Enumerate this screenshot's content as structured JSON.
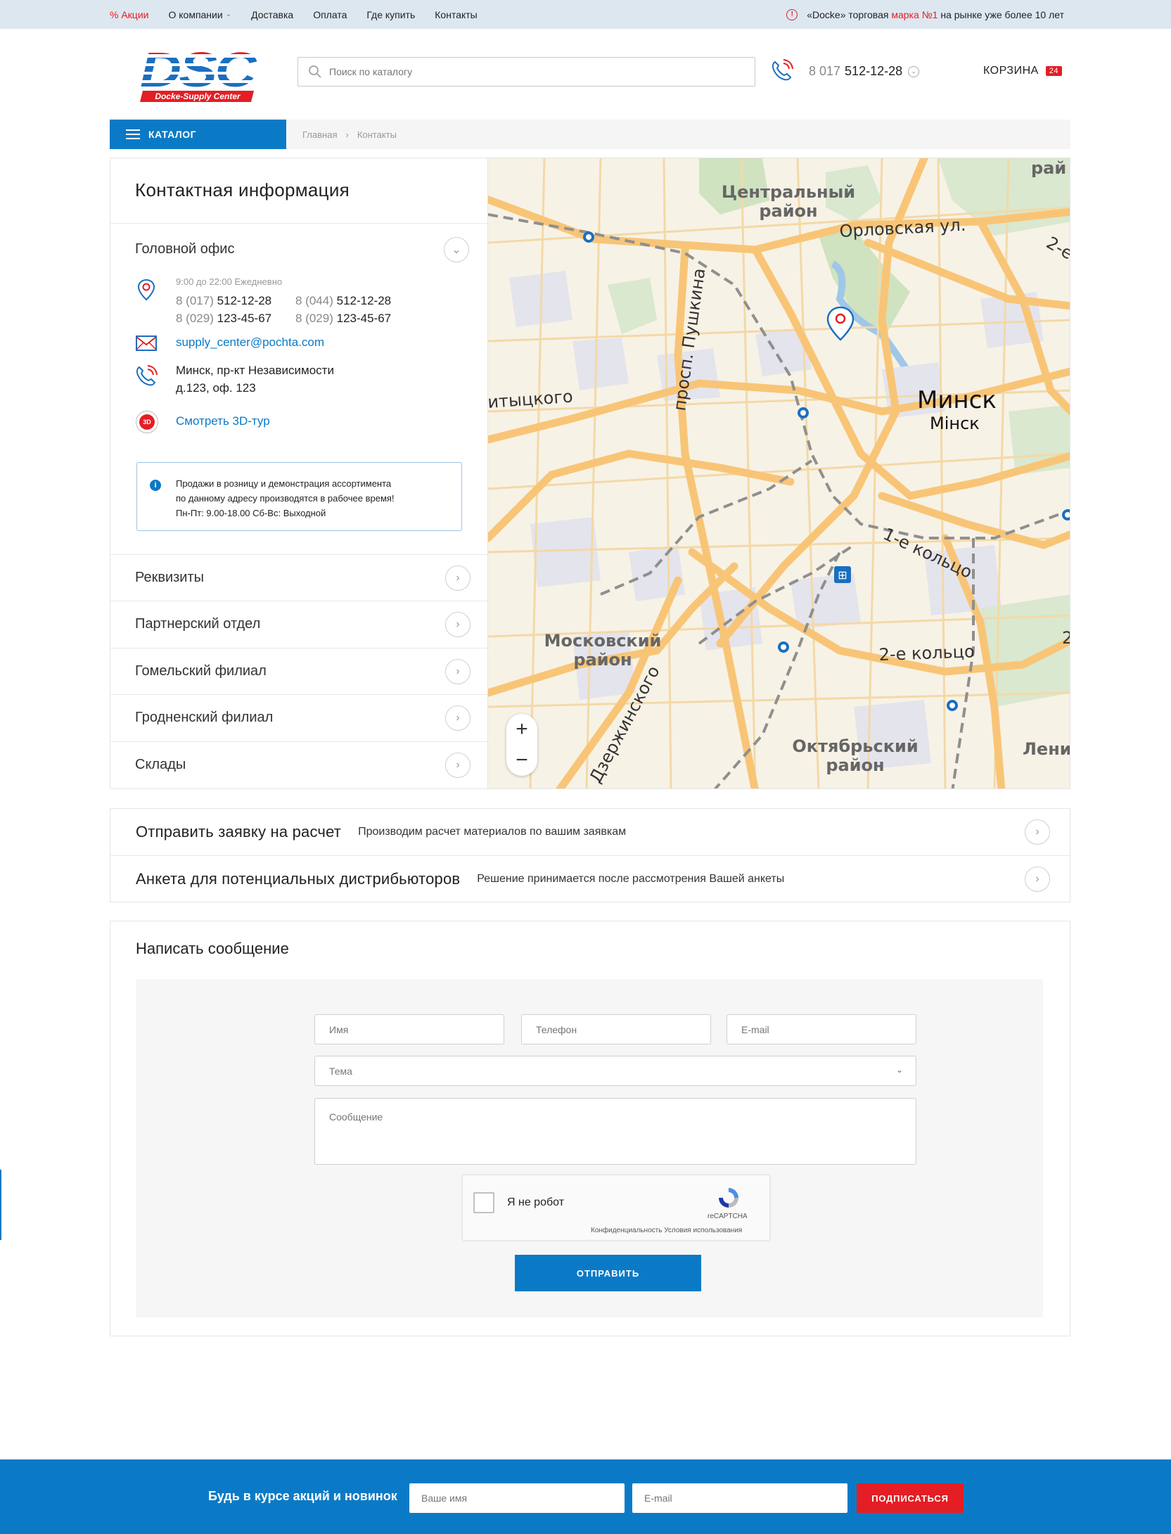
{
  "topbar": {
    "nav": [
      "% Акции",
      "О компании",
      "Доставка",
      "Оплата",
      "Где купить",
      "Контакты"
    ],
    "slogan_pre": "«Docke» торговая ",
    "slogan_red": "марка №1",
    "slogan_post": " на рынке уже более 10 лет"
  },
  "header": {
    "logo_text": "DSC",
    "logo_sub": "Docke-Supply Center",
    "search_placeholder": "Поиск по каталогу",
    "phone_code": "8 017",
    "phone_number": "512-12-28",
    "cart_label": "КОРЗИНА",
    "cart_count": "24"
  },
  "catalog_label": "КАТАЛОГ",
  "breadcrumbs": [
    "Главная",
    "Контакты"
  ],
  "contacts": {
    "title": "Контактная информация",
    "office_title": "Головной офис",
    "hours": "9:00 до 22:00 Ежедневно",
    "phones": [
      {
        "code": "8 (017)",
        "num": "512-12-28"
      },
      {
        "code": "8 (044)",
        "num": "512-12-28"
      },
      {
        "code": "8 (029)",
        "num": "123-45-67"
      },
      {
        "code": "8 (029)",
        "num": "123-45-67"
      }
    ],
    "email": "supply_center@pochta.com",
    "address_line1": "Минск, пр-кт Независимости",
    "address_line2": "д.123, оф. 123",
    "tour": "Смотреть 3D-тур",
    "tour_icon_text": "3D",
    "notice_lines": [
      "Продажи в розницу и демонстрация ассортимента",
      "по данному адресу производятся в рабочее время!",
      "Пн-Пт: 9.00-18.00 Сб-Вс: Выходной"
    ],
    "sections": [
      "Реквизиты",
      "Партнерский отдел",
      "Гомельский филиал",
      "Гродненский филиал",
      "Склады"
    ]
  },
  "map": {
    "labels": {
      "centr": [
        "Центральный",
        "район"
      ],
      "orlov": "Орловская ул.",
      "pushkin": "просп. Пушкина",
      "minsk": "Минск",
      "minsk_by": "Мінск",
      "itsk": "итыцкого",
      "ring1": "1-е кольцо",
      "ring2": "2-е кольцо",
      "mosk": [
        "Московский",
        "район"
      ],
      "dzerzh": "Дзержинского",
      "okt": [
        "Октябрьский",
        "район"
      ],
      "lenin": "Ленински",
      "ray": "рай",
      "ring2b": "2-е",
      "two": "2"
    },
    "zoom_in": "+",
    "zoom_out": "−"
  },
  "requests": [
    {
      "title": "Отправить заявку на расчет",
      "desc": "Производим расчет материалов по вашим заявкам"
    },
    {
      "title": "Анкета для потенциальных дистрибьюторов",
      "desc": "Решение принимается после рассмотрения Вашей анкеты"
    }
  ],
  "message": {
    "title": "Написать сообщение",
    "name_ph": "Имя",
    "phone_ph": "Телефон",
    "email_ph": "E-mail",
    "subject_ph": "Тема",
    "message_ph": "Сообщение",
    "captcha_label": "Я не робот",
    "captcha_brand": "reCAPTCHA",
    "captcha_terms": "Конфиденциальность Условия использования",
    "send": "ОТПРАВИТЬ"
  },
  "subscribe": {
    "title": "Будь в курсе акций и новинок",
    "name_ph": "Ваше имя",
    "email_ph": "E-mail",
    "button": "ПОДПИСАТЬСЯ"
  },
  "colors": {
    "accent": "#0b7ac6",
    "red": "#e31e24"
  }
}
